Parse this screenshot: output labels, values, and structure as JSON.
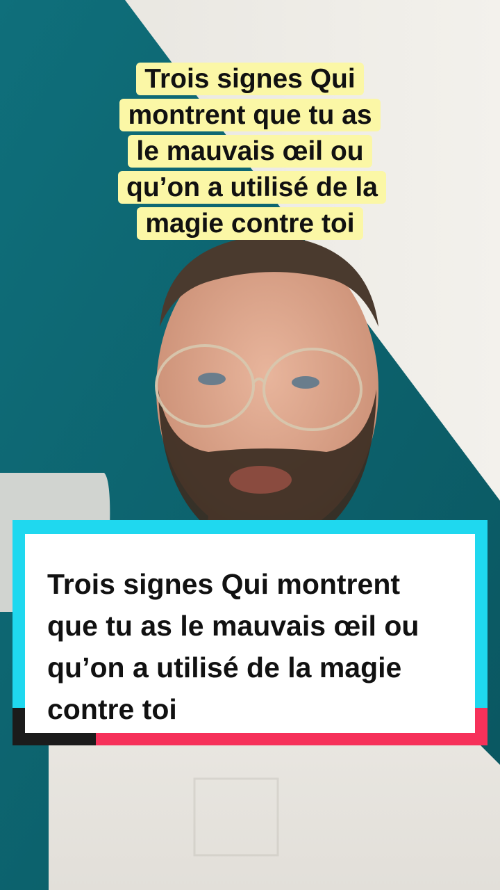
{
  "overlay": {
    "top_caption": "Trois signes Qui montrent que tu as le mauvais œil ou qu’on a utilisé de la magie contre toi",
    "card_text": "Trois signes Qui montrent que tu as le mauvais œil ou qu’on a utilisé de la magie contre toi"
  },
  "colors": {
    "caption_bg": "#fbf7a6",
    "card_cyan": "#1fd8ef",
    "card_red": "#f6315a",
    "wall_teal": "#10707a",
    "wall_light": "#e9e7e2"
  }
}
